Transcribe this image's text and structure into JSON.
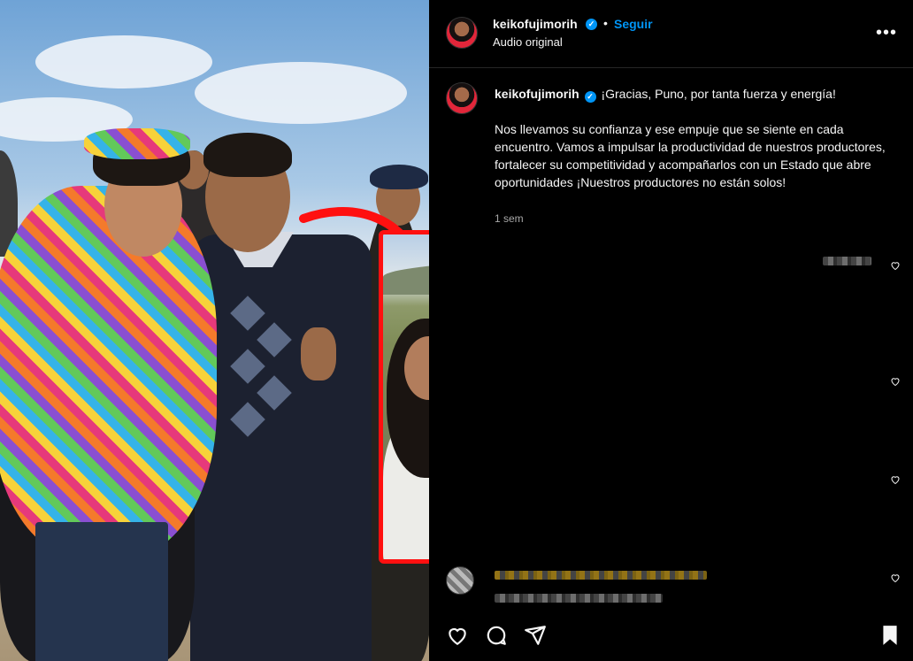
{
  "header": {
    "username": "keikofujimorih",
    "verified_icon": "verified-badge-icon",
    "separator": "•",
    "follow_label": "Seguir",
    "audio_label": "Audio original",
    "more_icon": "more-options-icon"
  },
  "caption": {
    "username": "keikofujimorih",
    "line1": "¡Gracias, Puno, por tanta fuerza y energía!",
    "body": "Nos llevamos su confianza y ese empuje que se siente en cada encuentro. Vamos a impulsar la productividad de nuestros productores, fortalecer su competitividad y acompañarlos con un Estado que abre oportunidades ¡Nuestros productores no están solos!",
    "time": "1 sem"
  },
  "actions": {
    "like_icon": "heart-icon",
    "comment_icon": "comment-icon",
    "share_icon": "share-icon",
    "save_icon": "bookmark-icon"
  },
  "colors": {
    "accent": "#0095f6",
    "highlight_border": "#ff1010",
    "background": "#000000",
    "text": "#f5f5f5",
    "muted": "#a8a8a8"
  }
}
